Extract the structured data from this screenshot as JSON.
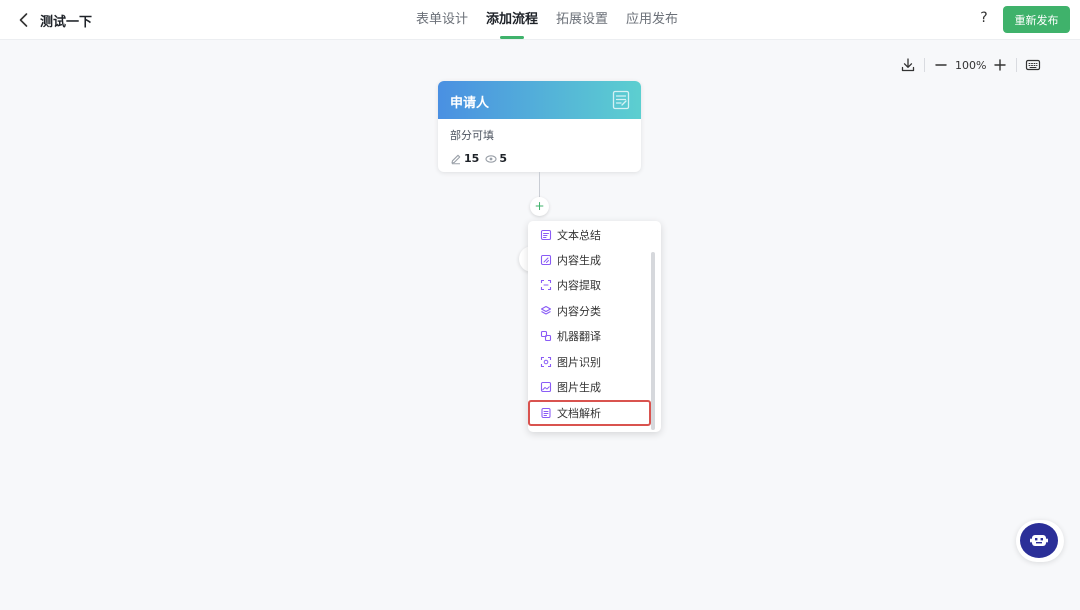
{
  "header": {
    "title": "测试一下",
    "tabs": [
      {
        "label": "表单设计",
        "active": false
      },
      {
        "label": "添加流程",
        "active": true
      },
      {
        "label": "拓展设置",
        "active": false
      },
      {
        "label": "应用发布",
        "active": false
      }
    ],
    "help_label": "?",
    "republish_label": "重新发布"
  },
  "canvas_toolbar": {
    "zoom": "100%"
  },
  "node": {
    "title": "申请人",
    "subtitle": "部分可填",
    "edit_count": "15",
    "view_count": "5"
  },
  "add_button_label": "+",
  "menu": {
    "items": [
      {
        "label": "文本总结",
        "icon": "text-summary-icon"
      },
      {
        "label": "内容生成",
        "icon": "content-generate-icon"
      },
      {
        "label": "内容提取",
        "icon": "content-extract-icon"
      },
      {
        "label": "内容分类",
        "icon": "layers-icon"
      },
      {
        "label": "机器翻译",
        "icon": "translate-icon"
      },
      {
        "label": "图片识别",
        "icon": "image-scan-icon"
      },
      {
        "label": "图片生成",
        "icon": "image-generate-icon"
      },
      {
        "label": "文档解析",
        "icon": "document-parse-icon"
      }
    ]
  },
  "colors": {
    "accent_green": "#3fb26b",
    "node_gradient_start": "#4a90e2",
    "node_gradient_end": "#5ccfd0",
    "menu_icon_purple": "#8a5cf6",
    "highlight_red": "#d9534f",
    "assistant_blue": "#2b2f98"
  }
}
